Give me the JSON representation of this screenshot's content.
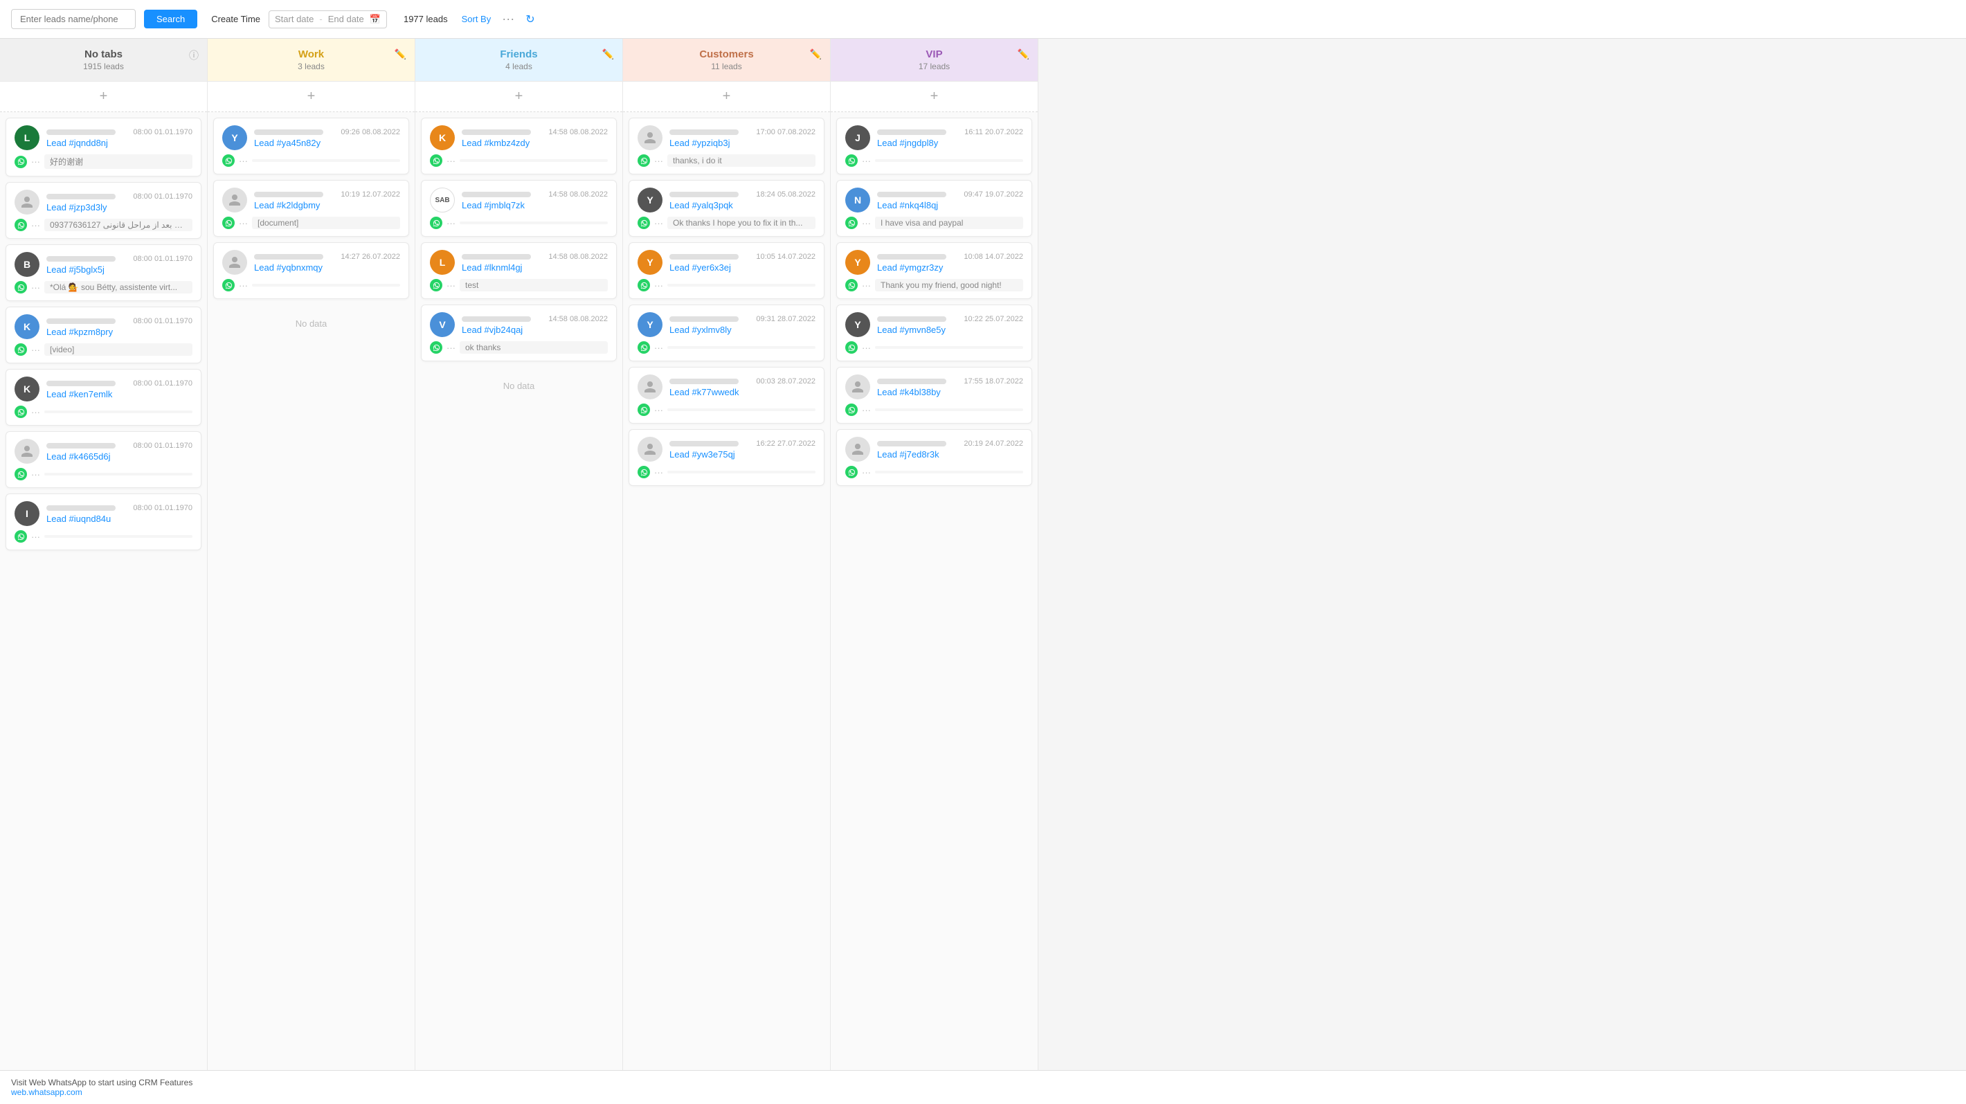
{
  "header": {
    "search_placeholder": "Enter leads name/phone",
    "search_label": "Search",
    "create_time_label": "Create Time",
    "start_date_placeholder": "Start date",
    "end_date_placeholder": "End date",
    "total_leads": "1977 leads",
    "sort_by_label": "Sort By"
  },
  "columns": [
    {
      "id": "notabs",
      "title": "No tabs",
      "leads_count": "1915 leads",
      "color_class": "col-notabs",
      "has_edit": false,
      "has_info": true,
      "cards": [
        {
          "id": "jqndd8nj",
          "lead": "Lead #jqndd8nj",
          "time": "08:00 01.01.1970",
          "msg": "好的谢谢",
          "has_msg": true,
          "avatar_type": "img",
          "avatar_color": "av-green",
          "avatar_text": "L",
          "avatar_img_color": "#1a7a3a"
        },
        {
          "id": "jzp3d3ly",
          "lead": "Lead #jzp3d3ly",
          "time": "08:00 01.01.1970",
          "msg": "09377636127 حساب بعد از مراحل قانونی",
          "has_msg": true,
          "avatar_type": "circle",
          "avatar_color": "av-gray",
          "avatar_text": ""
        },
        {
          "id": "j5bglx5j",
          "lead": "Lead #j5bglx5j",
          "time": "08:00 01.01.1970",
          "msg": "*Olá 💁 sou Bétty, assistente virt...",
          "has_msg": true,
          "avatar_type": "img_dark",
          "avatar_color": "av-dark",
          "avatar_text": "B"
        },
        {
          "id": "kpzm8pry",
          "lead": "Lead #kpzm8pry",
          "time": "08:00 01.01.1970",
          "msg": "[video]",
          "has_msg": true,
          "avatar_type": "img_landscape",
          "avatar_color": "av-blue",
          "avatar_text": "K"
        },
        {
          "id": "ken7emlk",
          "lead": "Lead #ken7emlk",
          "time": "08:00 01.01.1970",
          "msg": "...",
          "has_msg": false,
          "avatar_type": "circle",
          "avatar_color": "av-dark",
          "avatar_text": "K"
        },
        {
          "id": "k4665d6j",
          "lead": "Lead #k4665d6j",
          "time": "08:00 01.01.1970",
          "msg": "...",
          "has_msg": false,
          "avatar_type": "circle",
          "avatar_color": "av-gray",
          "avatar_text": ""
        },
        {
          "id": "iuqnd84u",
          "lead": "Lead #iuqnd84u",
          "time": "08:00 01.01.1970",
          "msg": "...",
          "has_msg": false,
          "avatar_type": "img_building",
          "avatar_color": "av-dark",
          "avatar_text": "I"
        }
      ]
    },
    {
      "id": "work",
      "title": "Work",
      "leads_count": "3 leads",
      "color_class": "col-work",
      "has_edit": true,
      "cards": [
        {
          "id": "ya45n82y",
          "lead": "Lead #ya45n82y",
          "time": "09:26 08.08.2022",
          "msg": "...",
          "has_msg": false,
          "avatar_type": "img_person",
          "avatar_color": "av-blue",
          "avatar_text": "Y"
        },
        {
          "id": "k2ldgbmy",
          "lead": "Lead #k2ldgbmy",
          "time": "10:19 12.07.2022",
          "msg": "[document]",
          "has_msg": true,
          "avatar_type": "circle",
          "avatar_color": "av-gray",
          "avatar_text": ""
        },
        {
          "id": "yqbnxmqy",
          "lead": "Lead #yqbnxmqy",
          "time": "14:27 26.07.2022",
          "msg": "...",
          "has_msg": false,
          "avatar_type": "circle",
          "avatar_color": "av-gray",
          "avatar_text": ""
        }
      ],
      "no_data": true
    },
    {
      "id": "friends",
      "title": "Friends",
      "leads_count": "4 leads",
      "color_class": "col-friends",
      "has_edit": true,
      "cards": [
        {
          "id": "kmbz4zdy",
          "lead": "Lead #kmbz4zdy",
          "time": "14:58 08.08.2022",
          "msg": "...",
          "has_msg": false,
          "avatar_type": "img_group",
          "avatar_color": "av-orange",
          "avatar_text": "K"
        },
        {
          "id": "jmblq7zk",
          "lead": "Lead #jmblq7zk",
          "time": "14:58 08.08.2022",
          "msg": "...",
          "has_msg": false,
          "avatar_type": "img_logo",
          "avatar_color": "av-blue",
          "avatar_text": "SAB"
        },
        {
          "id": "lknml4gj",
          "lead": "Lead #lknml4gj",
          "time": "14:58 08.08.2022",
          "msg": "test",
          "has_msg": true,
          "avatar_type": "img_dog",
          "avatar_color": "av-orange",
          "avatar_text": "L"
        },
        {
          "id": "vjb24qaj",
          "lead": "Lead #vjb24qaj",
          "time": "14:58 08.08.2022",
          "msg": "ok thanks",
          "has_msg": true,
          "avatar_type": "img_person2",
          "avatar_color": "av-blue",
          "avatar_text": "V"
        }
      ],
      "no_data": true
    },
    {
      "id": "customers",
      "title": "Customers",
      "leads_count": "11 leads",
      "color_class": "col-customers",
      "has_edit": true,
      "cards": [
        {
          "id": "ypziqb3j",
          "lead": "Lead #ypziqb3j",
          "time": "17:00 07.08.2022",
          "msg": "thanks, i do it",
          "has_msg": true,
          "avatar_type": "circle",
          "avatar_color": "av-gray",
          "avatar_text": ""
        },
        {
          "id": "yalq3pqk",
          "lead": "Lead #yalq3pqk",
          "time": "18:24 05.08.2022",
          "msg": "Ok thanks I hope you to fix it in th...",
          "has_msg": true,
          "avatar_type": "img_dark2",
          "avatar_color": "av-dark",
          "avatar_text": "Y"
        },
        {
          "id": "yer6x3ej",
          "lead": "Lead #yer6x3ej",
          "time": "10:05 14.07.2022",
          "msg": "...",
          "has_msg": false,
          "avatar_type": "img_person3",
          "avatar_color": "av-orange",
          "avatar_text": "Y"
        },
        {
          "id": "yxlmv8ly",
          "lead": "Lead #yxlmv8ly",
          "time": "09:31 28.07.2022",
          "msg": "...",
          "has_msg": false,
          "avatar_type": "img_person4",
          "avatar_color": "av-blue",
          "avatar_text": "Y"
        },
        {
          "id": "k77wwedk",
          "lead": "Lead #k77wwedk",
          "time": "00:03 28.07.2022",
          "msg": "...",
          "has_msg": false,
          "avatar_type": "circle",
          "avatar_color": "av-gray",
          "avatar_text": ""
        },
        {
          "id": "yw3e75qj",
          "lead": "Lead #yw3e75qj",
          "time": "16:22 27.07.2022",
          "msg": "...",
          "has_msg": false,
          "avatar_type": "circle",
          "avatar_color": "av-gray",
          "avatar_text": ""
        }
      ]
    },
    {
      "id": "vip",
      "title": "VIP",
      "leads_count": "17 leads",
      "color_class": "col-vip",
      "has_edit": true,
      "cards": [
        {
          "id": "jngdpl8y",
          "lead": "Lead #jngdpl8y",
          "time": "16:11 20.07.2022",
          "msg": "...",
          "has_msg": false,
          "avatar_type": "img_person5",
          "avatar_color": "av-dark",
          "avatar_text": "J"
        },
        {
          "id": "nkq4l8qj",
          "lead": "Lead #nkq4l8qj",
          "time": "09:47 19.07.2022",
          "msg": "I have visa and paypal",
          "has_msg": true,
          "avatar_type": "img_logo2",
          "avatar_color": "av-blue",
          "avatar_text": "N"
        },
        {
          "id": "ymgzr3zy",
          "lead": "Lead #ymgzr3zy",
          "time": "10:08 14.07.2022",
          "msg": "Thank you my friend, good night!",
          "has_msg": true,
          "avatar_type": "img_person6",
          "avatar_color": "av-orange",
          "avatar_text": "Y"
        },
        {
          "id": "ymvn8e5y",
          "lead": "Lead #ymvn8e5y",
          "time": "10:22 25.07.2022",
          "msg": "...",
          "has_msg": false,
          "avatar_type": "img_dark3",
          "avatar_color": "av-dark",
          "avatar_text": "Y"
        },
        {
          "id": "k4bl38by",
          "lead": "Lead #k4bl38by",
          "time": "17:55 18.07.2022",
          "msg": "...",
          "has_msg": false,
          "avatar_type": "circle",
          "avatar_color": "av-gray",
          "avatar_text": ""
        },
        {
          "id": "j7ed8r3k",
          "lead": "Lead #j7ed8r3k",
          "time": "20:19 24.07.2022",
          "msg": "...",
          "has_msg": false,
          "avatar_type": "circle",
          "avatar_color": "av-gray",
          "avatar_text": ""
        }
      ]
    }
  ],
  "footer": {
    "visit_text": "Visit Web WhatsApp to start using CRM Features",
    "link_text": "web.whatsapp.com",
    "link_url": "https://web.whatsapp.com"
  }
}
